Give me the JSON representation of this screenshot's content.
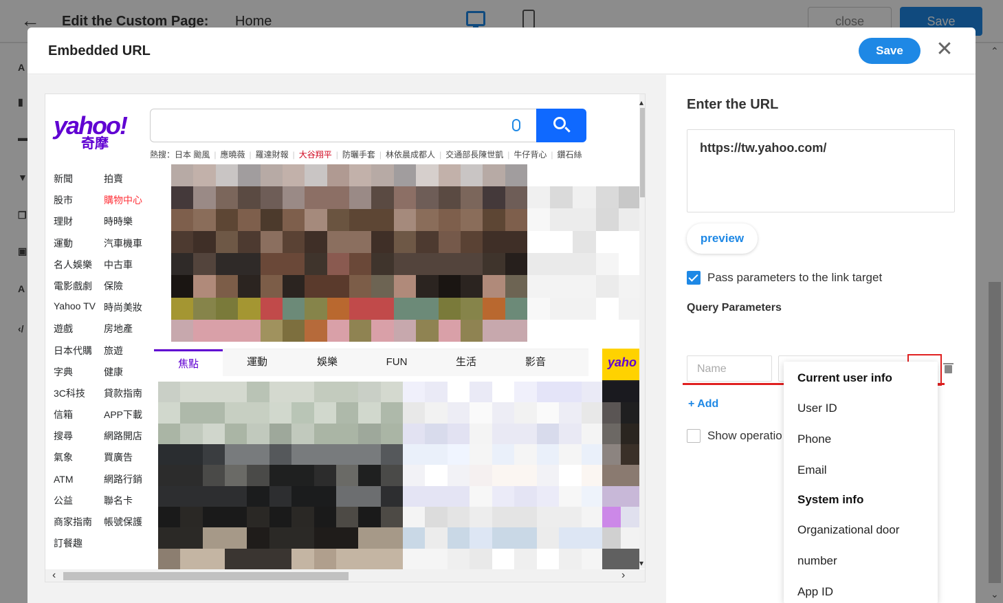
{
  "background": {
    "title": "Edit the Custom Page:",
    "page_name": "Home",
    "close_label": "close",
    "save_label": "Save",
    "left_icon_labels": [
      "A",
      "A"
    ]
  },
  "modal": {
    "title": "Embedded URL",
    "save_label": "Save",
    "close_glyph": "✕"
  },
  "yahoo": {
    "logo": "yahoo!",
    "logo_sub": "奇摩",
    "trending_prefix": "熱搜：",
    "trending": [
      "日本 颱風",
      "應曉薇",
      "羅達財報",
      "大谷翔平",
      "防曬手套",
      "林依晨成都人",
      "交通部長陳世凱",
      "牛仔背心",
      "鑽石絲"
    ],
    "nav_left": [
      "新聞",
      "股市",
      "理財",
      "運動",
      "名人娛樂",
      "電影戲劇",
      "Yahoo TV",
      "遊戲",
      "日本代購",
      "字典",
      "3C科技",
      "信箱",
      "搜尋",
      "氣象",
      "ATM",
      "公益",
      "商家指南",
      "訂餐趣"
    ],
    "nav_right": [
      "拍賣",
      "購物中心",
      "時時樂",
      "汽車機車",
      "中古車",
      "保險",
      "時尚美妝",
      "房地產",
      "旅遊",
      "健康",
      "貸款指南",
      "APP下載",
      "網路開店",
      "買廣告",
      "網路行銷",
      "聯名卡",
      "帳號保護"
    ],
    "tabs": [
      "焦點",
      "運動",
      "娛樂",
      "FUN",
      "生活",
      "影音"
    ],
    "ad_logo": "yaho"
  },
  "settings": {
    "url_title": "Enter the URL",
    "url_value": "https://tw.yahoo.com/",
    "preview_label": "preview",
    "pass_params_label": "Pass parameters to the link target",
    "pass_params_checked": true,
    "query_title": "Query Parameters",
    "name_placeholder": "Name",
    "value_placeholder": "Value",
    "add_label": "+ Add",
    "show_operation_label": "Show operatio",
    "show_operation_checked": false
  },
  "dropdown": {
    "items": [
      {
        "label": "Current user info",
        "group": true
      },
      {
        "label": "User ID",
        "group": false
      },
      {
        "label": "Phone",
        "group": false
      },
      {
        "label": "Email",
        "group": false
      },
      {
        "label": "System info",
        "group": true
      },
      {
        "label": "Organizational door",
        "group": false
      },
      {
        "label": "number",
        "group": false
      },
      {
        "label": "App ID",
        "group": false
      }
    ]
  },
  "colors": {
    "accent": "#1e88e5",
    "yahoo_purple": "#6001d2",
    "highlight_red": "#e02020"
  }
}
